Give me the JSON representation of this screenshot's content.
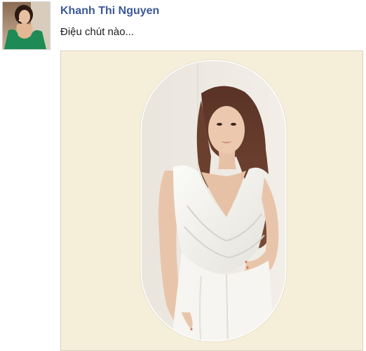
{
  "post": {
    "author_name": "Khanh Thi Nguyen",
    "status_text": "Điệu chút nào...",
    "avatar": {
      "icon": "profile-photo",
      "dress_color": "#1e8a55"
    },
    "photo": {
      "frame_color": "#f5efd9",
      "shape": "rounded-capsule"
    }
  },
  "colors": {
    "author_link": "#3b5998",
    "text": "#1c1c1c",
    "frame_background": "#f5efd9"
  }
}
